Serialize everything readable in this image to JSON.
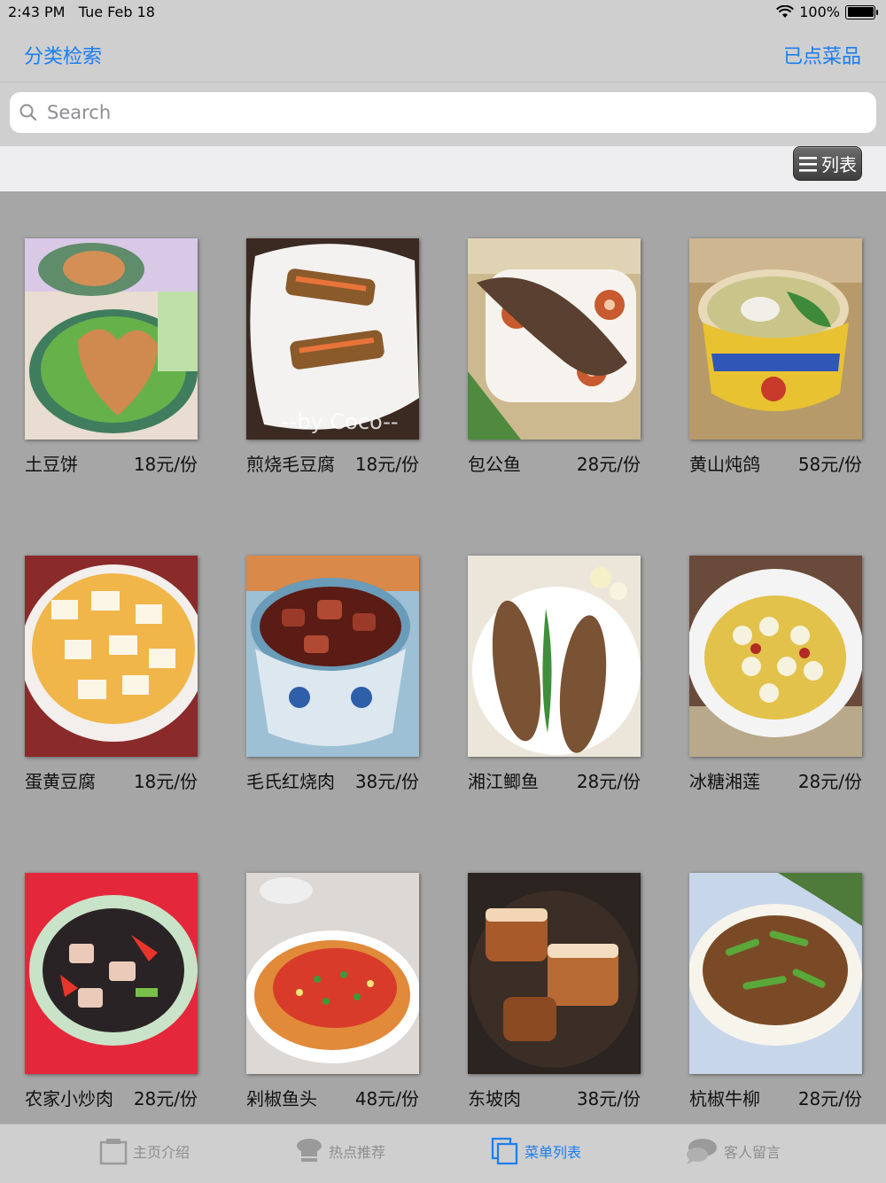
{
  "status_bar": {
    "time": "2:43 PM",
    "date": "Tue Feb 18",
    "battery": "100%",
    "battery_level": 1.0
  },
  "navbar": {
    "left_button": "分类检索",
    "right_button": "已点菜品"
  },
  "search": {
    "placeholder": "Search",
    "value": ""
  },
  "toolbar": {
    "list_button": "列表"
  },
  "dishes": [
    {
      "name": "土豆饼",
      "price": "18元/份",
      "image": "heart-shaped-potato-cake"
    },
    {
      "name": "煎烧毛豆腐",
      "price": "18元/份",
      "image": "fried-hairy-tofu"
    },
    {
      "name": "包公鱼",
      "price": "28元/份",
      "image": "fish-with-lotus-root"
    },
    {
      "name": "黄山炖鸽",
      "price": "58元/份",
      "image": "stewed-pigeon-soup"
    },
    {
      "name": "蛋黄豆腐",
      "price": "18元/份",
      "image": "egg-yolk-tofu"
    },
    {
      "name": "毛氏红烧肉",
      "price": "38元/份",
      "image": "braised-pork-bowl"
    },
    {
      "name": "湘江鲫鱼",
      "price": "28元/份",
      "image": "two-crucian-carp"
    },
    {
      "name": "冰糖湘莲",
      "price": "28元/份",
      "image": "lotus-seed-soup"
    },
    {
      "name": "农家小炒肉",
      "price": "28元/份",
      "image": "stir-fried-pork"
    },
    {
      "name": "剁椒鱼头",
      "price": "48元/份",
      "image": "chopped-chili-fish-head"
    },
    {
      "name": "东坡肉",
      "price": "38元/份",
      "image": "dongpo-pork"
    },
    {
      "name": "杭椒牛柳",
      "price": "28元/份",
      "image": "pepper-beef-strips"
    }
  ],
  "tabs": [
    {
      "label": "主页介绍",
      "icon": "home-icon",
      "active": false
    },
    {
      "label": "热点推荐",
      "icon": "chef-hat-icon",
      "active": false
    },
    {
      "label": "菜单列表",
      "icon": "menu-list-icon",
      "active": true
    },
    {
      "label": "客人留言",
      "icon": "chat-bubble-icon",
      "active": false
    }
  ]
}
